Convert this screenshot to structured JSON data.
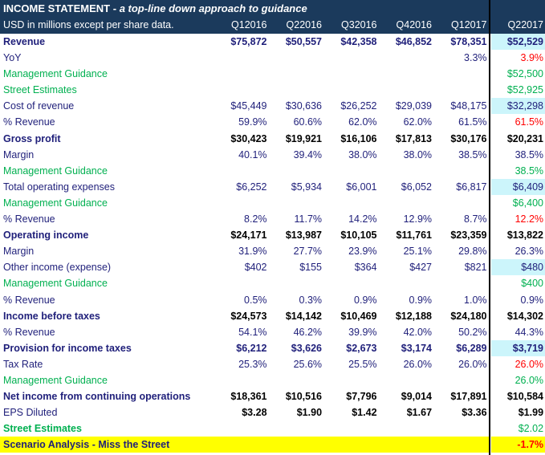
{
  "title": {
    "main": "INCOME STATEMENT",
    "sep": " - ",
    "subtitle": "a top-line down approach to guidance"
  },
  "header": {
    "label": "USD in millions except per share data.",
    "periods": [
      "Q12016",
      "Q22016",
      "Q32016",
      "Q42016",
      "Q12017"
    ],
    "forecast_period": "Q22017"
  },
  "colors": {
    "header_bg": "#1b3a5c",
    "label": "#1f1f7a",
    "guidance": "#00b050",
    "alert": "#ff0000",
    "highlight": "#ccf5fb",
    "scenario": "#ffff00"
  },
  "rows": [
    {
      "label": "Revenue",
      "values": [
        "$75,872",
        "$50,557",
        "$42,358",
        "$46,852",
        "$78,351"
      ],
      "forecast": "$52,529",
      "style": "bold bv",
      "fstyle": "hl"
    },
    {
      "label": "YoY",
      "values": [
        "",
        "",
        "",
        "",
        "3.3%"
      ],
      "forecast": "3.9%",
      "style": "",
      "fstyle": "red"
    },
    {
      "label": "Management Guidance",
      "values": [
        "",
        "",
        "",
        "",
        ""
      ],
      "forecast": "$52,500",
      "style": "green",
      "fstyle": ""
    },
    {
      "label": "Street Estimates",
      "values": [
        "",
        "",
        "",
        "",
        ""
      ],
      "forecast": "$52,925",
      "style": "green",
      "fstyle": ""
    },
    {
      "label": "Cost of revenue",
      "values": [
        "$45,449",
        "$30,636",
        "$26,252",
        "$29,039",
        "$48,175"
      ],
      "forecast": "$32,298",
      "style": "",
      "fstyle": "hl"
    },
    {
      "label": "% Revenue",
      "values": [
        "59.9%",
        "60.6%",
        "62.0%",
        "62.0%",
        "61.5%"
      ],
      "forecast": "61.5%",
      "style": "",
      "fstyle": "red"
    },
    {
      "label": "Gross profit",
      "values": [
        "$30,423",
        "$19,921",
        "$16,106",
        "$17,813",
        "$30,176"
      ],
      "forecast": "$20,231",
      "style": "bold bv bk",
      "fstyle": ""
    },
    {
      "label": "Margin",
      "values": [
        "40.1%",
        "39.4%",
        "38.0%",
        "38.0%",
        "38.5%"
      ],
      "forecast": "38.5%",
      "style": "",
      "fstyle": ""
    },
    {
      "label": "Management Guidance",
      "values": [
        "",
        "",
        "",
        "",
        ""
      ],
      "forecast": "38.5%",
      "style": "green",
      "fstyle": ""
    },
    {
      "label": "Total operating expenses",
      "values": [
        "$6,252",
        "$5,934",
        "$6,001",
        "$6,052",
        "$6,817"
      ],
      "forecast": "$6,409",
      "style": "",
      "fstyle": "hl"
    },
    {
      "label": "Management Guidance",
      "values": [
        "",
        "",
        "",
        "",
        ""
      ],
      "forecast": "$6,400",
      "style": "green",
      "fstyle": ""
    },
    {
      "label": "% Revenue",
      "values": [
        "8.2%",
        "11.7%",
        "14.2%",
        "12.9%",
        "8.7%"
      ],
      "forecast": "12.2%",
      "style": "",
      "fstyle": "red"
    },
    {
      "label": "Operating income",
      "values": [
        "$24,171",
        "$13,987",
        "$10,105",
        "$11,761",
        "$23,359"
      ],
      "forecast": "$13,822",
      "style": "bold bv bk",
      "fstyle": ""
    },
    {
      "label": "Margin",
      "values": [
        "31.9%",
        "27.7%",
        "23.9%",
        "25.1%",
        "29.8%"
      ],
      "forecast": "26.3%",
      "style": "",
      "fstyle": ""
    },
    {
      "label": "Other income (expense)",
      "values": [
        "$402",
        "$155",
        "$364",
        "$427",
        "$821"
      ],
      "forecast": "$480",
      "style": "",
      "fstyle": "hl"
    },
    {
      "label": "Management Guidance",
      "values": [
        "",
        "",
        "",
        "",
        ""
      ],
      "forecast": "$400",
      "style": "green",
      "fstyle": ""
    },
    {
      "label": "% Revenue",
      "values": [
        "0.5%",
        "0.3%",
        "0.9%",
        "0.9%",
        "1.0%"
      ],
      "forecast": "0.9%",
      "style": "",
      "fstyle": ""
    },
    {
      "label": "Income before taxes",
      "values": [
        "$24,573",
        "$14,142",
        "$10,469",
        "$12,188",
        "$24,180"
      ],
      "forecast": "$14,302",
      "style": "bold bv bk",
      "fstyle": ""
    },
    {
      "label": "% Revenue",
      "values": [
        "54.1%",
        "46.2%",
        "39.9%",
        "42.0%",
        "50.2%"
      ],
      "forecast": "44.3%",
      "style": "",
      "fstyle": ""
    },
    {
      "label": "Provision for income taxes",
      "values": [
        "$6,212",
        "$3,626",
        "$2,673",
        "$3,174",
        "$6,289"
      ],
      "forecast": "$3,719",
      "style": "bold bv",
      "fstyle": "hl"
    },
    {
      "label": "Tax Rate",
      "values": [
        "25.3%",
        "25.6%",
        "25.5%",
        "26.0%",
        "26.0%"
      ],
      "forecast": "26.0%",
      "style": "",
      "fstyle": "red"
    },
    {
      "label": "Management Guidance",
      "values": [
        "",
        "",
        "",
        "",
        ""
      ],
      "forecast": "26.0%",
      "style": "green",
      "fstyle": ""
    },
    {
      "label": "Net income from continuing operations",
      "values": [
        "$18,361",
        "$10,516",
        "$7,796",
        "$9,014",
        "$17,891"
      ],
      "forecast": "$10,584",
      "style": "bold bv bk",
      "fstyle": ""
    },
    {
      "label": "EPS Diluted",
      "values": [
        "$3.28",
        "$1.90",
        "$1.42",
        "$1.67",
        "$3.36"
      ],
      "forecast": "$1.99",
      "style": "bv bk",
      "fstyle": ""
    },
    {
      "label": "Street Estimates",
      "values": [
        "",
        "",
        "",
        "",
        ""
      ],
      "forecast": "$2.02",
      "style": "green bold",
      "fstyle": ""
    },
    {
      "label": "Scenario Analysis - Miss the Street",
      "values": [
        "",
        "",
        "",
        "",
        ""
      ],
      "forecast": "-1.7%",
      "style": "yellow",
      "fstyle": "red"
    }
  ]
}
